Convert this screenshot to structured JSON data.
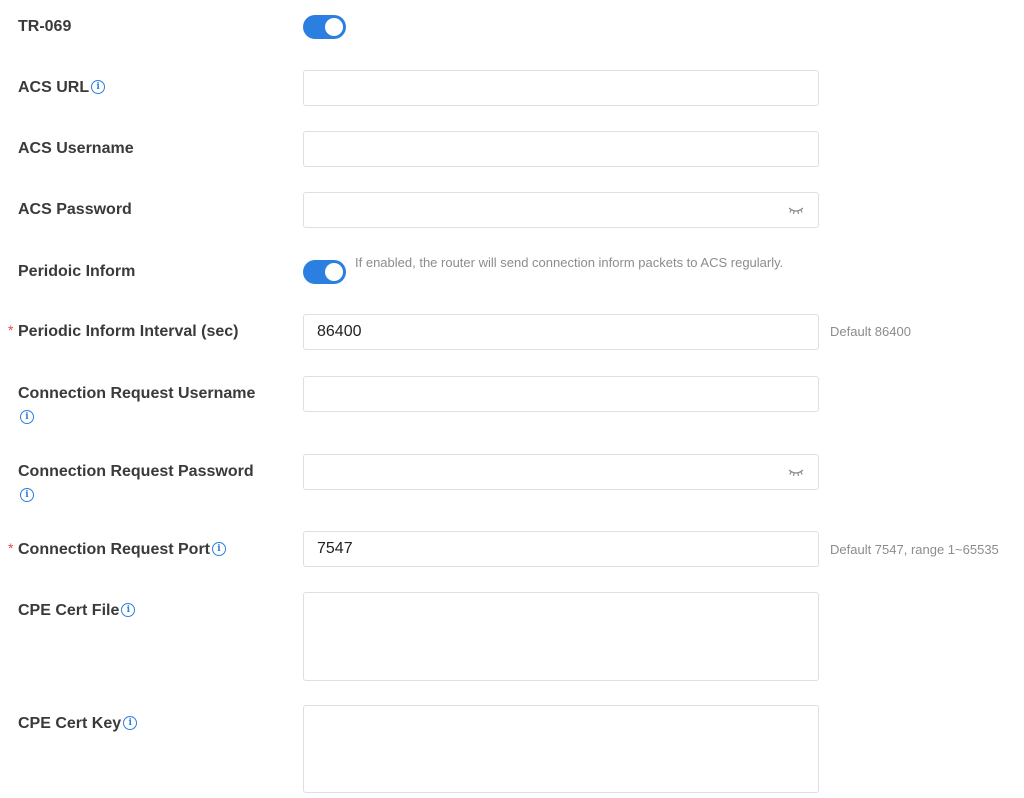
{
  "tr069": {
    "label": "TR-069",
    "enabled": true
  },
  "acs_url": {
    "label": "ACS URL",
    "value": ""
  },
  "acs_username": {
    "label": "ACS Username",
    "value": ""
  },
  "acs_password": {
    "label": "ACS Password",
    "value": ""
  },
  "periodic_inform": {
    "label": "Peridoic Inform",
    "enabled": true,
    "note": "If enabled, the router will send connection inform packets to ACS regularly."
  },
  "periodic_inform_interval": {
    "label": "Periodic Inform Interval (sec)",
    "required_mark": "*",
    "value": "86400",
    "hint": "Default 86400"
  },
  "conn_req_username": {
    "label": "Connection Request Username",
    "value": ""
  },
  "conn_req_password": {
    "label": "Connection Request Password",
    "value": ""
  },
  "conn_req_port": {
    "label": "Connection Request Port",
    "required_mark": "*",
    "value": "7547",
    "hint": "Default 7547, range 1~65535"
  },
  "cpe_cert_file": {
    "label": "CPE Cert File",
    "value": ""
  },
  "cpe_cert_key": {
    "label": "CPE Cert Key",
    "value": ""
  },
  "icons": {
    "info": "i",
    "info_icon_name": "info-circle-icon",
    "eye_icon_name": "eye-closed-icon"
  },
  "colors": {
    "accent": "#2b7fe0",
    "required": "#e5484d",
    "hint": "#8c8c8c"
  }
}
